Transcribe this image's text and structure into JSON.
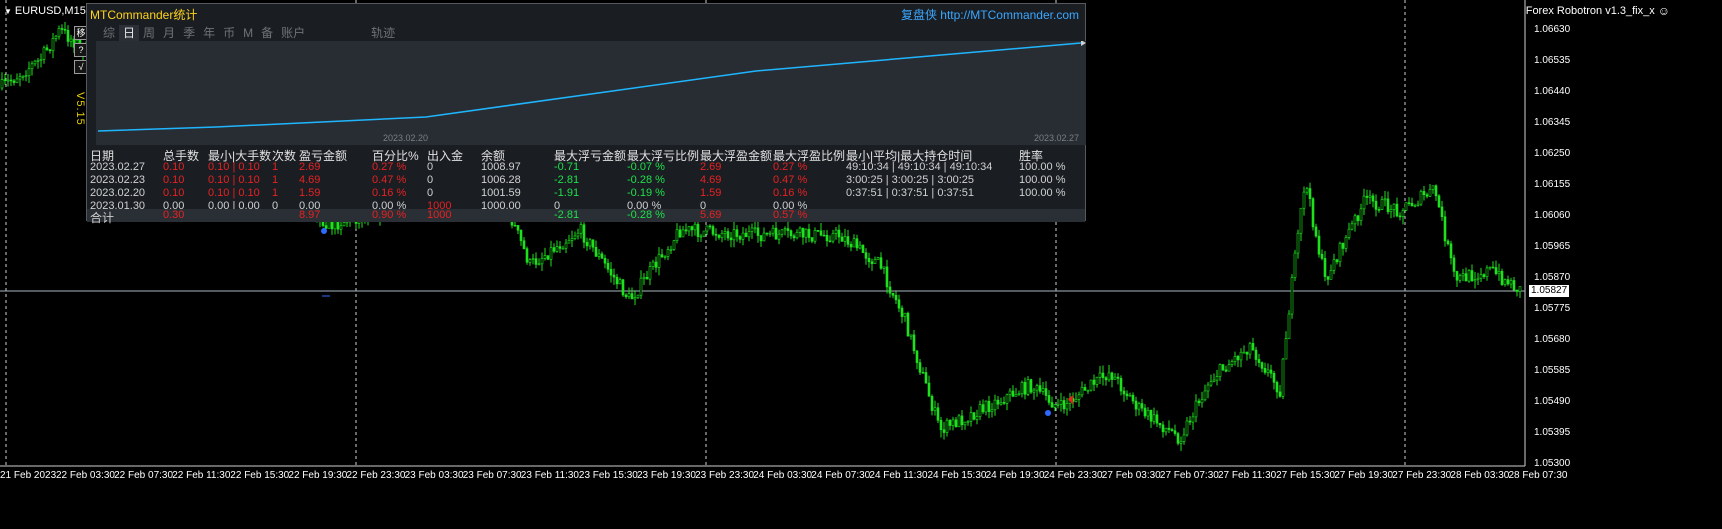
{
  "window": {
    "symbol": "EURUSD,M15",
    "ea_name": "Forex Robotron v1.3_fix_x",
    "version": "V5.15",
    "current_price": "1.05827"
  },
  "side_buttons": [
    "移",
    "?",
    "√"
  ],
  "panel": {
    "title": "MTCommander统计",
    "link": "复盘侠 http://MTCommander.com",
    "tabs": [
      "综",
      "日",
      "周",
      "月",
      "季",
      "年",
      "币",
      "M",
      "备",
      "账户",
      "轨迹"
    ],
    "active_tab": "日",
    "equity_dates": [
      "2023.02.20",
      "2023.02.27"
    ],
    "headers": [
      "日期",
      "总手数",
      "最小|大手数",
      "次数",
      "盈亏金额",
      "百分比%",
      "出入金",
      "余额",
      "最大浮亏金额",
      "最大浮亏比例",
      "最大浮盈金额",
      "最大浮盈比例",
      "最小|平均|最大持仓时间",
      "胜率"
    ],
    "rows": [
      [
        "2023.02.27",
        "0.10",
        "0.10 | 0.10",
        "1",
        "2.69",
        "0.27 %",
        "0",
        "1008.97",
        "-0.71",
        "-0.07 %",
        "2.69",
        "0.27 %",
        "49:10:34 | 49:10:34 | 49:10:34",
        "100.00 %"
      ],
      [
        "2023.02.23",
        "0.10",
        "0.10 | 0.10",
        "1",
        "4.69",
        "0.47 %",
        "0",
        "1006.28",
        "-2.81",
        "-0.28 %",
        "4.69",
        "0.47 %",
        "3:00:25 | 3:00:25 | 3:00:25",
        "100.00 %"
      ],
      [
        "2023.02.20",
        "0.10",
        "0.10 | 0.10",
        "1",
        "1.59",
        "0.16 %",
        "0",
        "1001.59",
        "-1.91",
        "-0.19 %",
        "1.59",
        "0.16 %",
        "0:37:51 | 0:37:51 | 0:37:51",
        "100.00 %"
      ],
      [
        "2023.01.30",
        "0.00",
        "0.00 | 0.00",
        "0",
        "0.00",
        "0.00 %",
        "1000",
        "1000.00",
        "0",
        "0.00 %",
        "0",
        "0.00 %",
        "",
        ""
      ]
    ],
    "total": [
      "合计",
      "0.30",
      "",
      "",
      "8.97",
      "0.90 %",
      "1000",
      "",
      "-2.81",
      "-0.28 %",
      "5.69",
      "0.57 %",
      "",
      ""
    ],
    "colors": {
      "title": "#ffd21a",
      "link": "#39a7ff",
      "profit": "#e62121",
      "loss": "#1ee04a",
      "equity": "#1fb6ff"
    }
  },
  "price_axis": [
    "1.06630",
    "1.06535",
    "1.06440",
    "1.06345",
    "1.06250",
    "1.06155",
    "1.06060",
    "1.05965",
    "1.05870",
    "1.05775",
    "1.05680",
    "1.05585",
    "1.05490",
    "1.05395",
    "1.05300"
  ],
  "time_axis": [
    "21 Feb 2023",
    "22 Feb 03:30",
    "22 Feb 07:30",
    "22 Feb 11:30",
    "22 Feb 15:30",
    "22 Feb 19:30",
    "22 Feb 23:30",
    "23 Feb 03:30",
    "23 Feb 07:30",
    "23 Feb 11:30",
    "23 Feb 15:30",
    "23 Feb 19:30",
    "23 Feb 23:30",
    "24 Feb 03:30",
    "24 Feb 07:30",
    "24 Feb 11:30",
    "24 Feb 15:30",
    "24 Feb 19:30",
    "24 Feb 23:30",
    "27 Feb 03:30",
    "27 Feb 07:30",
    "27 Feb 11:30",
    "27 Feb 15:30",
    "27 Feb 19:30",
    "27 Feb 23:30",
    "28 Feb 03:30",
    "28 Feb 07:30"
  ]
}
